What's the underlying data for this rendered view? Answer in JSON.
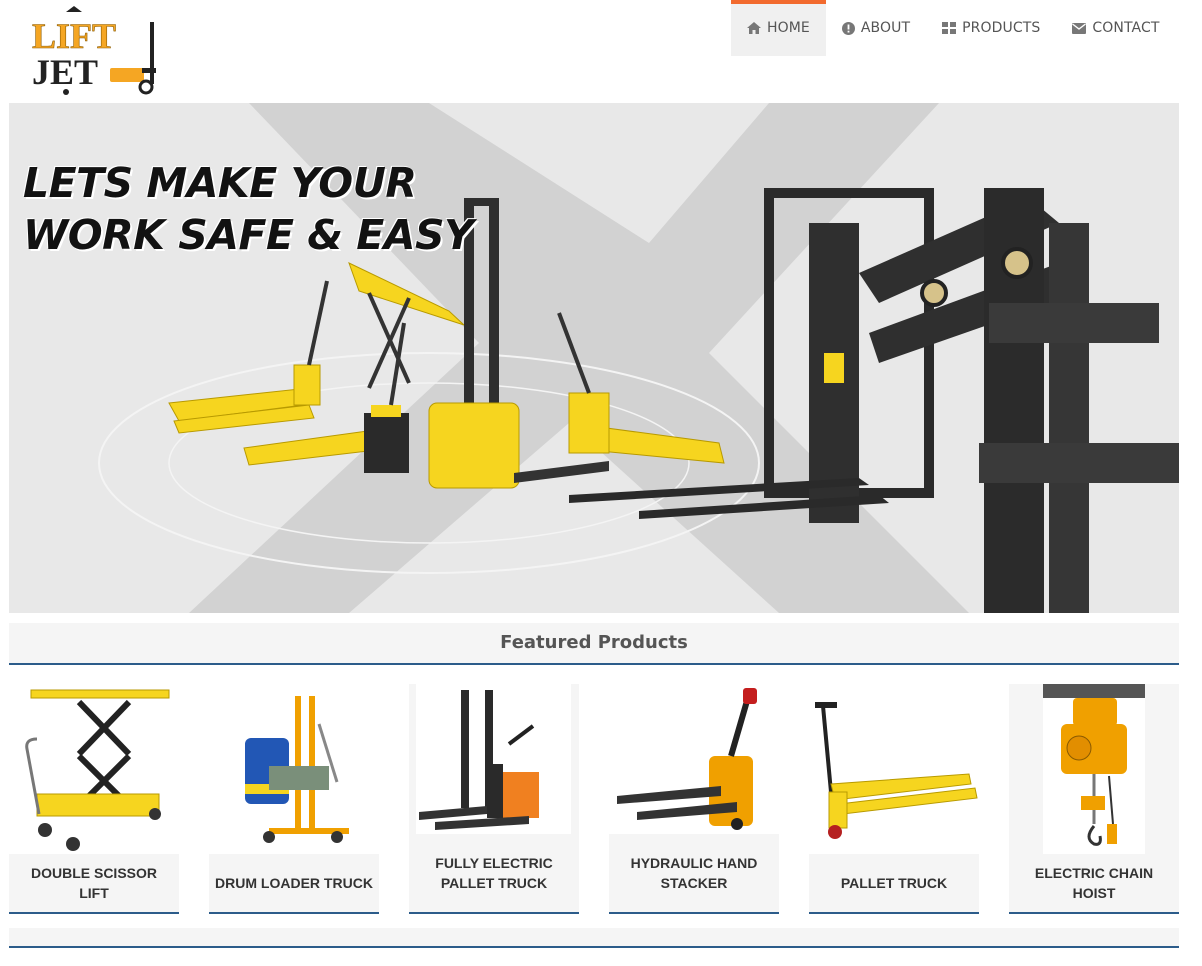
{
  "logo": {
    "line1": "LIFT",
    "line2": "JET"
  },
  "nav": [
    {
      "label": "HOME",
      "icon": "home-icon",
      "active": true
    },
    {
      "label": "ABOUT",
      "icon": "info-circle-icon",
      "active": false
    },
    {
      "label": "PRODUCTS",
      "icon": "grid-icon",
      "active": false
    },
    {
      "label": "CONTACT",
      "icon": "envelope-icon",
      "active": false
    }
  ],
  "hero": {
    "line1": "LETS MAKE YOUR",
    "line2": "WORK SAFE & EASY"
  },
  "featured": {
    "title": "Featured Products",
    "products": [
      {
        "name": "DOUBLE SCISSOR LIFT"
      },
      {
        "name": "DRUM LOADER TRUCK"
      },
      {
        "name": "FULLY ELECTRIC PALLET TRUCK"
      },
      {
        "name": "HYDRAULIC HAND STACKER"
      },
      {
        "name": "PALLET TRUCK"
      },
      {
        "name": "ELECTRIC CHAIN HOIST"
      }
    ]
  },
  "colors": {
    "accent": "#f26a2e",
    "rule": "#2c5c8a",
    "brand_yellow": "#f5a623",
    "equipment_yellow": "#f6d51f"
  }
}
